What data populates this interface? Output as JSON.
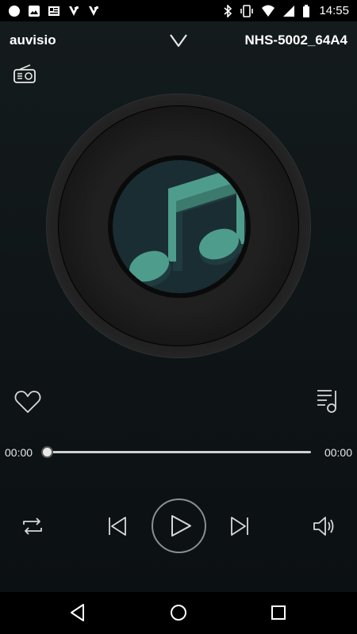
{
  "status_bar": {
    "time": "14:55",
    "left_icons": [
      "notification-dot-icon",
      "image-icon",
      "newsreader-icon",
      "app-badge-icon",
      "app-badge-icon"
    ],
    "right_icons": [
      "bluetooth-icon",
      "vibrate-icon",
      "wifi-icon",
      "signal-icon",
      "battery-icon"
    ]
  },
  "header": {
    "brand": "auvisio",
    "device_name": "NHS-5002_64A4"
  },
  "player": {
    "current_time": "00:00",
    "total_time": "00:00",
    "progress": 0
  },
  "colors": {
    "accent": "#4e9c8c",
    "background": "#111719",
    "disc_label": "#1a2d33"
  }
}
